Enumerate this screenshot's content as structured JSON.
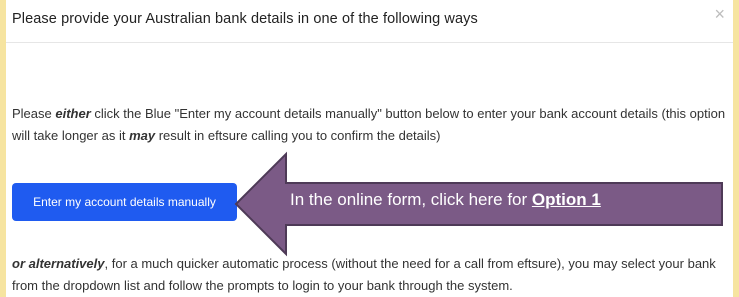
{
  "dialog": {
    "title": "Please provide your Australian bank details in one of the following ways",
    "close_glyph": "×"
  },
  "paragraph1": {
    "part1": "Please ",
    "either": "either",
    "part2": " click the Blue \"Enter my account details manually\" button below to enter your bank account details (this option will take longer as it ",
    "may": "may",
    "part3": " result in eftsure calling you to confirm the details)"
  },
  "manual_button": {
    "label": "Enter my account details manually",
    "color": "#1f5bf0"
  },
  "callout": {
    "text": "In the online form, click here for ",
    "option": "Option 1",
    "fill": "#7b5a86",
    "stroke": "#4e3a57"
  },
  "paragraph2": {
    "alternatively": "or alternatively",
    "text": ", for a much quicker automatic process (without the need for a call from eftsure), you may select your bank from the dropdown list and follow the prompts to login to your bank through the system."
  }
}
